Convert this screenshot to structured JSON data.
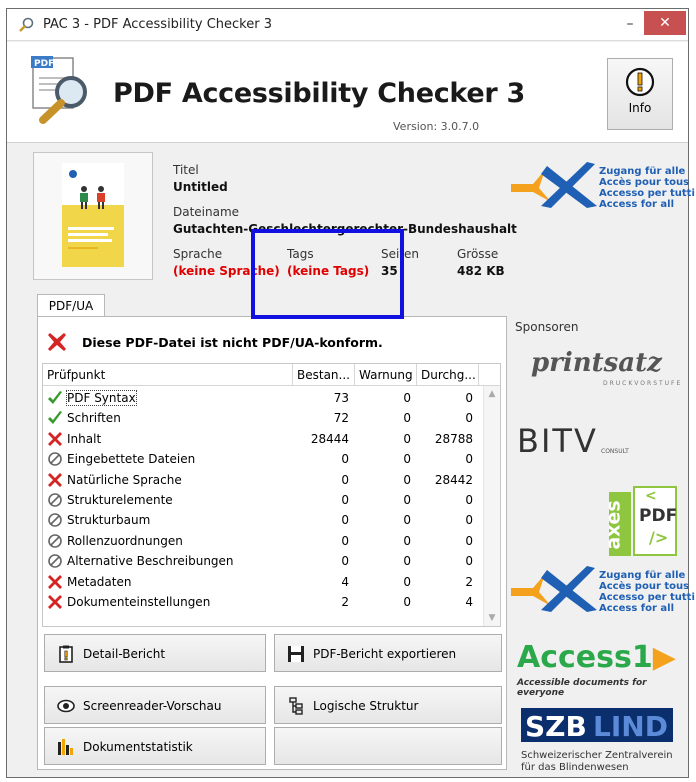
{
  "window": {
    "title": "PAC 3 - PDF Accessibility Checker 3",
    "minimize": "–",
    "close": "✕"
  },
  "header": {
    "app_name": "PDF Accessibility Checker 3",
    "version": "Version: 3.0.7.0",
    "info_label": "Info",
    "logo_text": "PDF"
  },
  "file": {
    "titel_label": "Titel",
    "titel_value": "Untitled",
    "dateiname_label": "Dateiname",
    "dateiname_value": "Gutachten-Geschlechtergerechter-Bundeshaushalt",
    "sprache_label": "Sprache",
    "sprache_value": "(keine Sprache)",
    "tags_label": "Tags",
    "tags_value": "(keine Tags)",
    "seiten_label": "Seiten",
    "seiten_value": "35",
    "groesse_label": "Grösse",
    "groesse_value": "482 KB"
  },
  "tab": {
    "label": "PDF/UA"
  },
  "result": {
    "message": "Diese PDF-Datei ist nicht PDF/UA-konform."
  },
  "table": {
    "headers": [
      "Prüfpunkt",
      "Bestan...",
      "Warnung",
      "Durchg..."
    ],
    "rows": [
      {
        "status": "pass",
        "name": "PDF Syntax",
        "bestanden": "73",
        "warnung": "0",
        "durchgefallen": "0"
      },
      {
        "status": "pass",
        "name": "Schriften",
        "bestanden": "72",
        "warnung": "0",
        "durchgefallen": "0"
      },
      {
        "status": "fail",
        "name": "Inhalt",
        "bestanden": "28444",
        "warnung": "0",
        "durchgefallen": "28788"
      },
      {
        "status": "none",
        "name": "Eingebettete Dateien",
        "bestanden": "0",
        "warnung": "0",
        "durchgefallen": "0"
      },
      {
        "status": "fail",
        "name": "Natürliche Sprache",
        "bestanden": "0",
        "warnung": "0",
        "durchgefallen": "28442"
      },
      {
        "status": "none",
        "name": "Strukturelemente",
        "bestanden": "0",
        "warnung": "0",
        "durchgefallen": "0"
      },
      {
        "status": "none",
        "name": "Strukturbaum",
        "bestanden": "0",
        "warnung": "0",
        "durchgefallen": "0"
      },
      {
        "status": "none",
        "name": "Rollenzuordnungen",
        "bestanden": "0",
        "warnung": "0",
        "durchgefallen": "0"
      },
      {
        "status": "none",
        "name": "Alternative Beschreibungen",
        "bestanden": "0",
        "warnung": "0",
        "durchgefallen": "0"
      },
      {
        "status": "fail",
        "name": "Metadaten",
        "bestanden": "4",
        "warnung": "0",
        "durchgefallen": "2"
      },
      {
        "status": "fail",
        "name": "Dokumenteinstellungen",
        "bestanden": "2",
        "warnung": "0",
        "durchgefallen": "4"
      }
    ]
  },
  "buttons": {
    "detail": "Detail-Bericht",
    "export": "PDF-Bericht exportieren",
    "screenreader": "Screenreader-Vorschau",
    "logische": "Logische Struktur",
    "statistik": "Dokumentstatistik"
  },
  "sidebar": {
    "zugang_lines": [
      "Zugang für alle",
      "Accès pour tous",
      "Accesso per tutti",
      "Access for all"
    ],
    "sponsoren_label": "Sponsoren",
    "printsatz": "printsatz",
    "printsatz_sub": "DRUCKVORSTUFE",
    "bitv": "BITV",
    "bitv_sub": "CONSULT",
    "axes": "axes",
    "axes_pdf": "PDF",
    "access1": "Access1",
    "access1_sub": "Accessible documents for everyone",
    "szb_a": "SZB",
    "szb_b": "LIND",
    "szb_sub1": "Schweizerischer Zentralverein",
    "szb_sub2": "für das Blindenwesen"
  },
  "colors": {
    "fail": "#e00000",
    "pass": "#3a9a2e",
    "highlight": "#1010e0",
    "brand_blue": "#1f5fb4",
    "brand_orange": "#f4a21d"
  }
}
